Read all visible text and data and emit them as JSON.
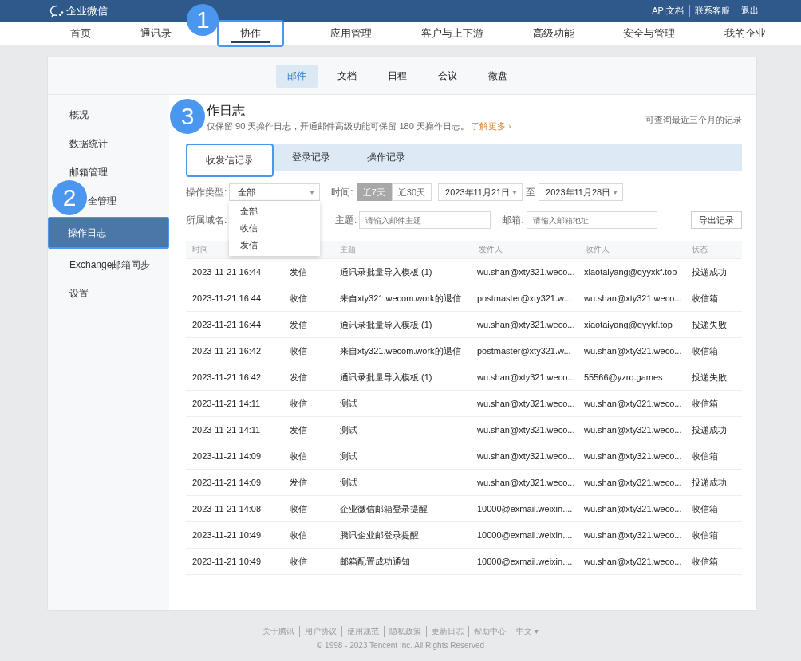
{
  "topbar": {
    "logo": "企业微信",
    "links": [
      "API文档",
      "联系客服",
      "退出"
    ]
  },
  "nav": [
    {
      "label": "首页",
      "selected": false,
      "highlighted": false
    },
    {
      "label": "通讯录",
      "selected": false,
      "highlighted": false
    },
    {
      "label": "协作",
      "selected": true,
      "highlighted": true,
      "callout": "1"
    },
    {
      "label": "应用管理",
      "selected": false,
      "highlighted": false
    },
    {
      "label": "客户与上下游",
      "selected": false,
      "highlighted": false
    },
    {
      "label": "高级功能",
      "selected": false,
      "highlighted": false
    },
    {
      "label": "安全与管理",
      "selected": false,
      "highlighted": false
    },
    {
      "label": "我的企业",
      "selected": false,
      "highlighted": false
    }
  ],
  "subnav": [
    {
      "label": "邮件",
      "selected": true
    },
    {
      "label": "文档",
      "selected": false
    },
    {
      "label": "日程",
      "selected": false
    },
    {
      "label": "会议",
      "selected": false
    },
    {
      "label": "微盘",
      "selected": false
    }
  ],
  "sidebar": {
    "items": [
      {
        "label": "概况",
        "selected": false,
        "highlighted": false
      },
      {
        "label": "数据统计",
        "selected": false,
        "highlighted": false
      },
      {
        "label": "邮箱管理",
        "selected": false,
        "highlighted": false
      },
      {
        "label": "全管理",
        "selected": false,
        "highlighted": false,
        "callout": "2"
      },
      {
        "label": "操作日志",
        "selected": true,
        "highlighted": true
      },
      {
        "label": "Exchange邮箱同步",
        "selected": false,
        "highlighted": false
      },
      {
        "label": "设置",
        "selected": false,
        "highlighted": false
      }
    ]
  },
  "header": {
    "title": "作日志",
    "subtitle": "仅保留 90 天操作日志，开通邮件高级功能可保留 180 天操作日志。",
    "link": "了解更多 ›",
    "note": "可查询最近三个月的记录",
    "callout": "3"
  },
  "tabs": [
    {
      "label": "收发信记录",
      "selected": true,
      "highlighted": true
    },
    {
      "label": "登录记录",
      "selected": false,
      "highlighted": false
    },
    {
      "label": "操作记录",
      "selected": false,
      "highlighted": false
    }
  ],
  "filters": {
    "type_label": "操作类型:",
    "type_value": "全部",
    "type_options": [
      "全部",
      "收信",
      "发信"
    ],
    "time_label": "时间:",
    "ranges": [
      {
        "label": "近7天",
        "selected": true
      },
      {
        "label": "近30天",
        "selected": false
      }
    ],
    "date_from": "2023年11月21日",
    "date_sep": "至",
    "date_to": "2023年11月28日",
    "domain_label": "所属域名:",
    "subject_label": "主题:",
    "subject_placeholder": "请输入邮件主题",
    "mailbox_label": "邮箱:",
    "mailbox_placeholder": "请输入邮箱地址",
    "export": "导出记录"
  },
  "table": {
    "columns": [
      {
        "label": "时间"
      },
      {},
      {
        "label": "主题"
      },
      {
        "label": "发件人"
      },
      {
        "label": "收件人"
      },
      {
        "label": "状态"
      }
    ],
    "rows": [
      [
        "2023-11-21 16:44",
        "发信",
        "通讯录批量导入模板 (1)",
        "wu.shan@xty321.weco...",
        "xiaotaiyang@qyyxkf.top",
        "投递成功"
      ],
      [
        "2023-11-21 16:44",
        "收信",
        "来自xty321.wecom.work的退信",
        "postmaster@xty321.w...",
        "wu.shan@xty321.weco...",
        "收信箱"
      ],
      [
        "2023-11-21 16:44",
        "发信",
        "通讯录批量导入模板 (1)",
        "wu.shan@xty321.weco...",
        "xiaotaiyang@qyykf.top",
        "投递失败"
      ],
      [
        "2023-11-21 16:42",
        "收信",
        "来自xty321.wecom.work的退信",
        "postmaster@xty321.w...",
        "wu.shan@xty321.weco...",
        "收信箱"
      ],
      [
        "2023-11-21 16:42",
        "发信",
        "通讯录批量导入模板 (1)",
        "wu.shan@xty321.weco...",
        "55566@yzrq.games",
        "投递失败"
      ],
      [
        "2023-11-21 14:11",
        "收信",
        "测试",
        "wu.shan@xty321.weco...",
        "wu.shan@xty321.weco...",
        "收信箱"
      ],
      [
        "2023-11-21 14:11",
        "发信",
        "测试",
        "wu.shan@xty321.weco...",
        "wu.shan@xty321.weco...",
        "投递成功"
      ],
      [
        "2023-11-21 14:09",
        "收信",
        "测试",
        "wu.shan@xty321.weco...",
        "wu.shan@xty321.weco...",
        "收信箱"
      ],
      [
        "2023-11-21 14:09",
        "发信",
        "测试",
        "wu.shan@xty321.weco...",
        "wu.shan@xty321.weco...",
        "投递成功"
      ],
      [
        "2023-11-21 14:08",
        "收信",
        "企业微信邮箱登录提醒",
        "10000@exmail.weixin....",
        "wu.shan@xty321.weco...",
        "收信箱"
      ],
      [
        "2023-11-21 10:49",
        "收信",
        "腾讯企业邮登录提醒",
        "10000@exmail.weixin....",
        "wu.shan@xty321.weco...",
        "收信箱"
      ],
      [
        "2023-11-21 10:49",
        "收信",
        "邮箱配置成功通知",
        "10000@exmail.weixin....",
        "wu.shan@xty321.weco...",
        "收信箱"
      ]
    ]
  },
  "footer": {
    "links": [
      "关于腾讯",
      "用户协议",
      "使用规范",
      "隐私政策",
      "更新日志",
      "帮助中心",
      "中文 ▾"
    ],
    "copyright": "© 1998 - 2023 Tencent Inc. All Rights Reserved"
  }
}
